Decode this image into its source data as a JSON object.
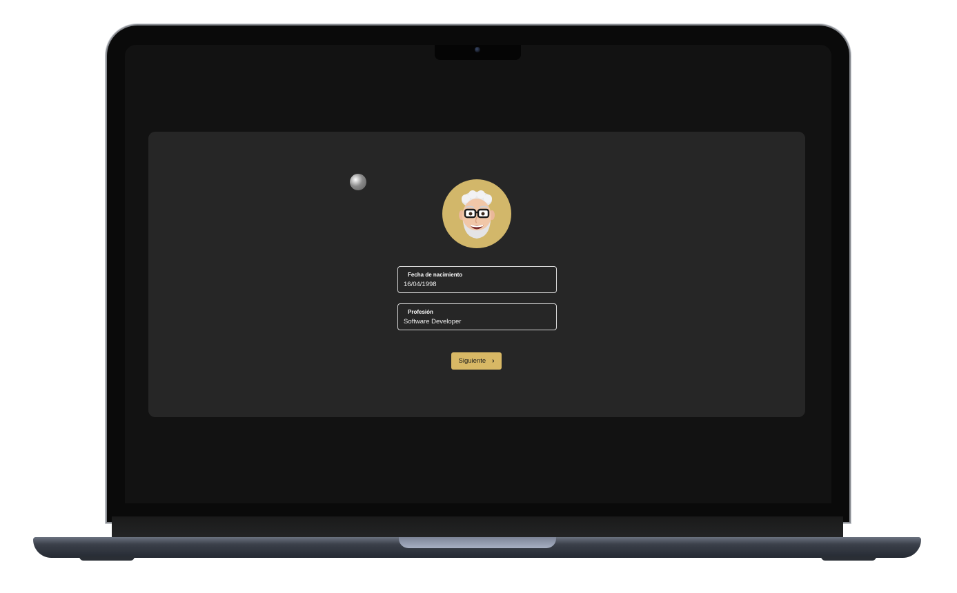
{
  "form": {
    "birthdate_label": "Fecha de nacimiento",
    "birthdate_value": "16/04/1998",
    "profession_label": "Profesión",
    "profession_value": "Software Developer",
    "next_button_label": "Siguiente",
    "next_button_icon": "›"
  },
  "colors": {
    "accent": "#d8b865",
    "panel": "#262626",
    "screen": "#121212"
  },
  "icons": [
    "avatar-memoji",
    "chevron-right-icon",
    "cursor-dot"
  ]
}
